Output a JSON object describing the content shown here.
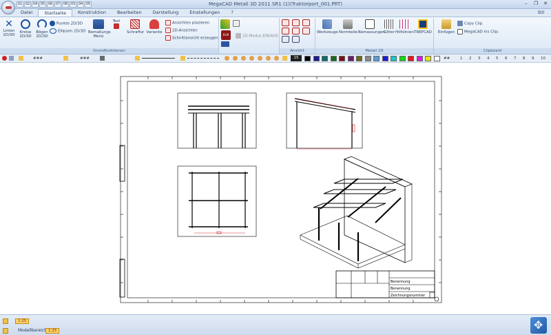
{
  "window": {
    "title": "MegaCAD Metall 3D 2011 SR1 (1)(Traktorport_001.PRT)",
    "qat_items": [
      "01",
      "02",
      "04",
      "05",
      "06",
      "07",
      "08",
      "03",
      "04",
      "05"
    ],
    "style_label": "Stil"
  },
  "tabs": [
    "Datei",
    "Startseite",
    "Konstruktion",
    "Bearbeiten",
    "Darstellung",
    "Einstellungen",
    "?"
  ],
  "ribbon": {
    "groups": {
      "grundfunktionen": "Grundfunktionen",
      "ansicht": "Ansicht",
      "metall2d": "Metall 2D",
      "clipboard": "Clipboard"
    },
    "buttons": {
      "linien": "Linien 2D/3D",
      "kreise": "Kreise 2D/3D",
      "boegen": "Bögen 2D/3D",
      "punkte": "Punkte 2D/3D",
      "ellipsen": "Ellipsen 2D/3D",
      "bemassungs_menue": "Bemaßungs Menü",
      "text": "Text",
      "schraffur": "Schraffur",
      "variante": "Variante",
      "ansichten_platzieren": "Ansichten plazieren",
      "ansichten_2d": "2D-Ansichten",
      "schnittansicht": "Schnittansicht erzeugen",
      "modus_2d": "2D-Modus EIN/AUS",
      "werkzeuge": "Werkzeuge",
      "normteile": "Normteile",
      "bemassungen": "Bemassungen",
      "gitter": "Gitter",
      "hilfslinien": "Hilfslinien",
      "trepcad": "TREPCAD",
      "einfuegen": "Einfügen",
      "copy_clip": "Copy Clip.",
      "megacad_ins_clip": "MegaCAD ins Clip."
    }
  },
  "toolbar": {
    "hash1": "###",
    "hash2": "###",
    "hash3": "##",
    "hash4": "##",
    "layer_value": "15",
    "layer_numbers": [
      "1",
      "2",
      "3",
      "4",
      "5",
      "6",
      "7",
      "8",
      "9",
      "10"
    ],
    "colors": [
      "#000000",
      "#1b1b8f",
      "#0f6b6b",
      "#186b18",
      "#7a1010",
      "#6b1b6b",
      "#6b6b1b",
      "#8a8a8a",
      "#5b9bd5",
      "#1c1cd6",
      "#16c8c8",
      "#16d616",
      "#e21b1b",
      "#e01be0",
      "#e6e61b",
      "#ffffff"
    ]
  },
  "drawing": {
    "titleblock": {
      "benennung1": "Benennung",
      "benennung2": "Benennung",
      "zeichnungsnummer": "Zeichnungsnummer"
    }
  },
  "status": {
    "scale_badge": "1:25",
    "model_label": "Modellbereich",
    "model_scale": "1:25"
  }
}
